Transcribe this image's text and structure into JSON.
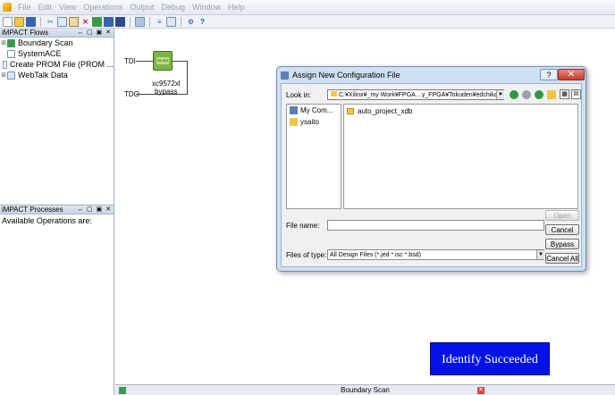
{
  "menu": [
    "File",
    "Edit",
    "View",
    "Operations",
    "Output",
    "Debug",
    "Window",
    "Help"
  ],
  "toolbar_icons": [
    "new-icon",
    "open-icon",
    "save-icon",
    "cut-icon",
    "copy-icon",
    "paste-icon",
    "delete-icon",
    "grid-icon",
    "layout-icon",
    "program-icon",
    "cable-icon",
    "chain-icon",
    "config-icon",
    "settings-icon",
    "help-icon"
  ],
  "flows_panel": {
    "title": "iMPACT Flows",
    "controls": "↔ ▢ ▣ ✕",
    "items": [
      "Boundary Scan",
      "SystemACE",
      "Create PROM File (PROM ...",
      "WebTalk Data"
    ]
  },
  "processes_panel": {
    "title": "iMPACT Processes",
    "controls": "↔ ▢ ▣ ✕",
    "text": "Available Operations are:"
  },
  "canvas": {
    "tdi": "TDI",
    "tdo": "TDO",
    "chip_logo": "XILINX",
    "device_name": "xc9572xl",
    "device_mode": "bypass"
  },
  "bottom_tab": {
    "title": "Boundary Scan"
  },
  "dialog": {
    "title": "Assign New Configuration File",
    "help_label": "?",
    "close_label": "✕",
    "look_in_label": "Look in:",
    "look_in_value": "C:¥Xilinx¥_my Work¥FPGA…y_FPGA¥Tokuden¥edchika",
    "places": [
      "My Com...",
      "ysaito"
    ],
    "files": [
      "auto_project_xdb"
    ],
    "file_name_label": "File name:",
    "file_name_value": "",
    "file_type_label": "Files of type:",
    "file_type_value": "All Design Files (*.jed *.isc *.bsd)",
    "buttons": {
      "open": "Open",
      "cancel": "Cancel",
      "bypass": "Bypass",
      "cancel_all": "Cancel All"
    }
  },
  "status_popup": "Identify Succeeded",
  "colors": {
    "popup_bg": "#0012e8",
    "chip": "#7fb347"
  }
}
